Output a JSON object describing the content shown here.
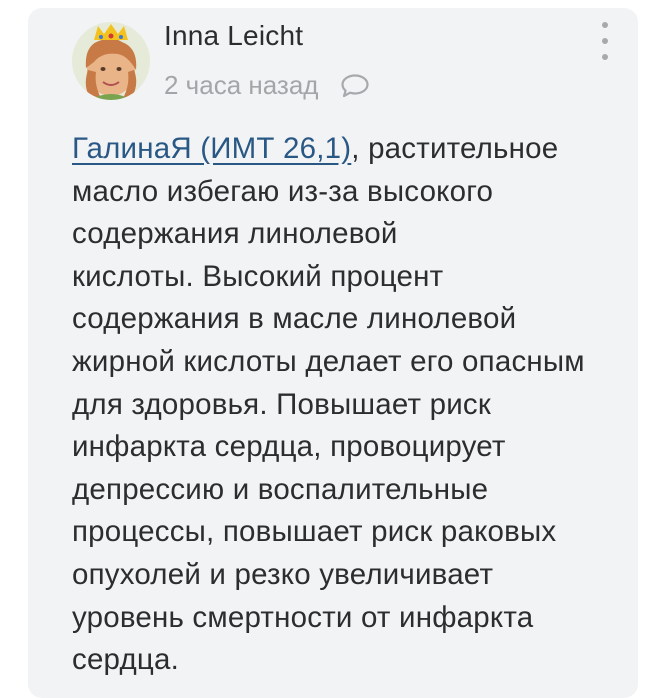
{
  "comment": {
    "author": "Inna Leicht",
    "timestamp": "2 часа назад",
    "mention": "ГалинаЯ (ИМТ 26,1)",
    "lines": [
      ", растительное",
      "масло избегаю из-за высокого",
      "содержания линолевой",
      "кислоты. Высокий процент",
      "содержания в масле линолевой",
      "жирной кислоты делает его опасным",
      "для здоровья. Повышает риск",
      "инфаркта сердца, провоцирует",
      "депрессию и воспалительные",
      "процессы, повышает риск раковых",
      "опухолей и резко увеличивает",
      "уровень смертности от инфаркта",
      "сердца."
    ]
  },
  "icons": {
    "avatar": "avatar-photo",
    "reply": "comment-bubble-icon",
    "menu": "more-vertical-icon"
  },
  "colors": {
    "card_background": "#f2f3f5",
    "text": "#2c2d2e",
    "muted": "#a3a5a8",
    "link": "#2a5885"
  }
}
